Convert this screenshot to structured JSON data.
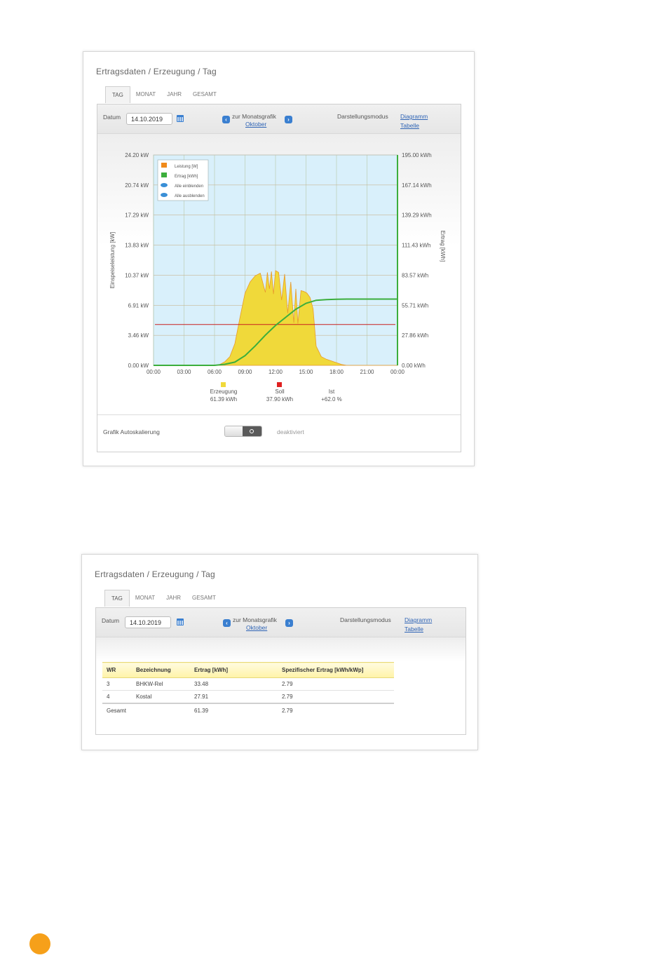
{
  "panel1": {
    "title": "Ertragsdaten / Erzeugung / Tag",
    "tabs": [
      "TAG",
      "MONAT",
      "JAHR",
      "GESAMT"
    ],
    "datum_label": "Datum",
    "datum_value": "14.10.2019",
    "nav_label": "zur Monatsgrafik",
    "nav_sub": "Oktober",
    "mode_label": "Darstellungsmodus",
    "mode_diagram": "Diagramm",
    "mode_table": "Tabelle",
    "autoscale_label": "Grafik Autoskalierung",
    "autoscale_state": "deaktiviert"
  },
  "chart_data": {
    "type": "area",
    "xlabel": "",
    "ylabel": "Einspeiseleistung [kW]",
    "y2label": "Ertrag [kWh]",
    "x_ticks": [
      "00:00",
      "03:00",
      "06:00",
      "09:00",
      "12:00",
      "15:00",
      "18:00",
      "21:00",
      "00:00"
    ],
    "y_ticks": [
      "0.00 kW",
      "3.46 kW",
      "6.91 kW",
      "10.37 kW",
      "13.83 kW",
      "17.29 kW",
      "20.74 kW",
      "24.20 kW"
    ],
    "y2_ticks": [
      "0.00 kWh",
      "27.86 kWh",
      "55.71 kWh",
      "83.57 kWh",
      "111.43 kWh",
      "139.29 kWh",
      "167.14 kWh",
      "195.00 kWh"
    ],
    "ylim": [
      0,
      24.2
    ],
    "y2lim": [
      0,
      195
    ],
    "xlim": [
      0,
      24
    ],
    "legend": [
      "Leistung [W]",
      "Ertrag [kWh]",
      "Alle einblenden",
      "Alle ausblenden"
    ],
    "legend_position": "top-left",
    "grid": true,
    "soll_line_kw": 4.7,
    "series": [
      {
        "name": "Leistung [W]",
        "color": "#f0d93a",
        "x": [
          0,
          6.0,
          6.5,
          7.0,
          7.5,
          8.0,
          8.5,
          9.0,
          9.5,
          10.0,
          10.5,
          11.0,
          11.2,
          11.4,
          11.6,
          11.8,
          12.0,
          12.3,
          12.6,
          12.9,
          13.2,
          13.5,
          13.8,
          14.0,
          14.2,
          14.5,
          14.8,
          15.1,
          15.4,
          15.7,
          16.0,
          16.5,
          17.0,
          17.5,
          18.0,
          18.5,
          19.0,
          24
        ],
        "values": [
          0,
          0,
          0.1,
          0.4,
          1.0,
          2.5,
          5.5,
          8.3,
          9.6,
          10.3,
          10.6,
          8.4,
          10.7,
          8.8,
          10.8,
          8.2,
          10.9,
          10.7,
          7.5,
          10.5,
          6.0,
          9.6,
          4.9,
          8.8,
          4.8,
          8.6,
          8.5,
          8.3,
          7.8,
          6.5,
          2.2,
          1.0,
          0.7,
          0.5,
          0.3,
          0.1,
          0,
          0
        ]
      },
      {
        "name": "Ertrag [kWh]",
        "color": "#3cae3c",
        "axis": "right",
        "x": [
          0,
          6.0,
          7.0,
          8.0,
          9.0,
          10.0,
          11.0,
          12.0,
          13.0,
          14.0,
          15.0,
          16.0,
          17.0,
          18.0,
          19.0,
          24
        ],
        "values": [
          0,
          0,
          1.0,
          3.0,
          9.0,
          18.0,
          28.0,
          37.0,
          44.5,
          52.0,
          57.5,
          60.3,
          61.0,
          61.3,
          61.4,
          61.4
        ]
      }
    ],
    "summary": [
      {
        "label": "Erzeugung",
        "value": "61.39 kWh",
        "color": "#f0d93a"
      },
      {
        "label": "Soll",
        "value": "37.90 kWh",
        "color": "#e02020"
      },
      {
        "label": "Ist",
        "value": "+62.0 %"
      }
    ]
  },
  "panel2": {
    "title": "Ertragsdaten / Erzeugung / Tag",
    "tabs": [
      "TAG",
      "MONAT",
      "JAHR",
      "GESAMT"
    ],
    "datum_label": "Datum",
    "datum_value": "14.10.2019",
    "nav_label": "zur Monatsgrafik",
    "nav_sub": "Oktober",
    "mode_label": "Darstellungsmodus",
    "mode_diagram": "Diagramm",
    "mode_table": "Tabelle",
    "table": {
      "headers": [
        "WR",
        "Bezeichnung",
        "Ertrag [kWh]",
        "Spezifischer Ertrag [kWh/kWp]"
      ],
      "rows": [
        [
          "3",
          "BHKW-Rel",
          "33.48",
          "2.79"
        ],
        [
          "4",
          "Kostal",
          "27.91",
          "2.79"
        ]
      ],
      "total": [
        "Gesamt",
        "",
        "61.39",
        "2.79"
      ]
    }
  },
  "colors": {
    "plot_bg": "#d9f0fb",
    "link": "#2f64b5",
    "accent_orange": "#f6a01a",
    "soll_line": "#c81e1e"
  }
}
